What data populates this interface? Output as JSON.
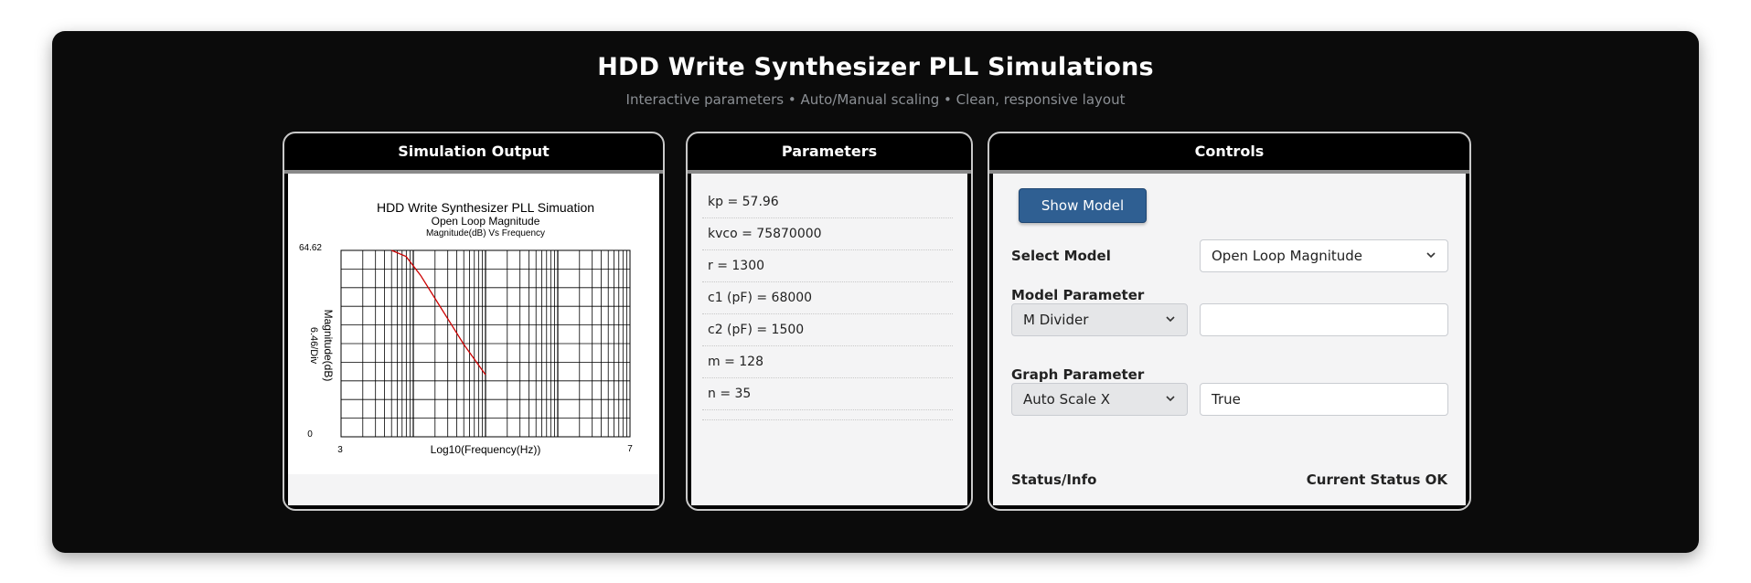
{
  "header": {
    "title": "HDD Write Synthesizer PLL Simulations",
    "subtitle": "Interactive parameters • Auto/Manual scaling • Clean, responsive layout"
  },
  "panels": {
    "simulation_title": "Simulation Output",
    "parameters_title": "Parameters",
    "controls_title": "Controls"
  },
  "parameters": [
    "kp = 57.96",
    "kvco = 75870000",
    "r = 1300",
    "c1 (pF) = 68000",
    "c2 (pF) = 1500",
    "m = 128",
    "n = 35"
  ],
  "controls": {
    "show_model_label": "Show Model",
    "select_model_label": "Select Model",
    "select_model_value": "Open Loop Magnitude",
    "model_parameter_label": "Model Parameter",
    "model_parameter_value": "M Divider",
    "model_parameter_input": "",
    "graph_parameter_label": "Graph Parameter",
    "graph_parameter_value": "Auto Scale X",
    "graph_parameter_input": "True",
    "status_label": "Status/Info",
    "status_value": "Current Status OK"
  },
  "chart_data": {
    "type": "line",
    "title": "HDD Write Synthesizer PLL Simuation",
    "subtitle": "Open Loop Magnitude",
    "subsubtitle": "Magnitude(dB) Vs Frequency",
    "xlabel": "Log10(Frequency(Hz))",
    "ylabel": "Magnitude(dB)",
    "ylabel2": "6.46/Div",
    "x_tick_labels": [
      "3",
      "7"
    ],
    "y_tick_labels": [
      "64.62",
      "0"
    ],
    "xlim": [
      3,
      7
    ],
    "ylim": [
      0,
      64.62
    ],
    "x_scale": "log",
    "grid": true,
    "line_color": "#cc0000",
    "series": [
      {
        "x": [
          3.7,
          3.9,
          4.1,
          4.3,
          4.5,
          4.7,
          5.0
        ],
        "y": [
          64.62,
          62.5,
          56.0,
          48.0,
          40.0,
          32.0,
          21.5
        ]
      }
    ]
  }
}
